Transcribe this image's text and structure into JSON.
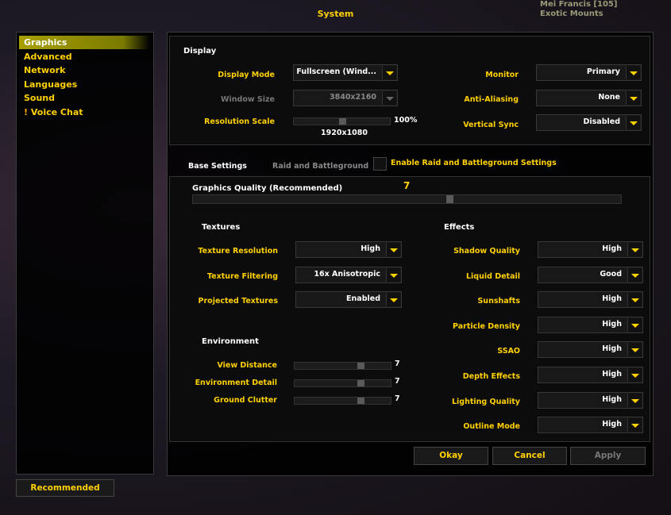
{
  "window_title": "System",
  "background_text": [
    "Mei Francis [105]",
    "Exotic Mounts"
  ],
  "colors": {
    "accent": "#ffd100",
    "selected_nav": "#a8a000"
  },
  "sidebar": {
    "items": [
      {
        "label": "Graphics",
        "selected": true
      },
      {
        "label": "Advanced"
      },
      {
        "label": "Network"
      },
      {
        "label": "Languages"
      },
      {
        "label": "Sound"
      },
      {
        "label": "Voice Chat",
        "icon": "exclamation-icon"
      }
    ]
  },
  "display": {
    "heading": "Display",
    "display_mode": {
      "label": "Display Mode",
      "value": "Fullscreen (Wind..."
    },
    "window_size": {
      "label": "Window Size",
      "value": "3840x2160"
    },
    "resolution_scale": {
      "label": "Resolution Scale",
      "value": "100%",
      "resolution": "1920x1080",
      "percent": 50
    },
    "monitor": {
      "label": "Monitor",
      "value": "Primary"
    },
    "anti_aliasing": {
      "label": "Anti-Aliasing",
      "value": "None"
    },
    "vertical_sync": {
      "label": "Vertical Sync",
      "value": "Disabled"
    }
  },
  "tabs": {
    "base": "Base Settings",
    "raid": "Raid and Battleground",
    "enable_raid": "Enable Raid and Battleground Settings",
    "enable_raid_checked": false
  },
  "graphics_quality": {
    "label": "Graphics Quality (Recommended)",
    "value": "7",
    "fraction": 0.6
  },
  "textures": {
    "heading": "Textures",
    "items": [
      {
        "label": "Texture Resolution",
        "value": "High"
      },
      {
        "label": "Texture Filtering",
        "value": "16x Anisotropic"
      },
      {
        "label": "Projected Textures",
        "value": "Enabled"
      }
    ]
  },
  "environment": {
    "heading": "Environment",
    "items": [
      {
        "label": "View Distance",
        "value": "7"
      },
      {
        "label": "Environment Detail",
        "value": "7"
      },
      {
        "label": "Ground Clutter",
        "value": "7"
      }
    ]
  },
  "effects": {
    "heading": "Effects",
    "items": [
      {
        "label": "Shadow Quality",
        "value": "High"
      },
      {
        "label": "Liquid Detail",
        "value": "Good"
      },
      {
        "label": "Sunshafts",
        "value": "High"
      },
      {
        "label": "Particle Density",
        "value": "High"
      },
      {
        "label": "SSAO",
        "value": "High"
      },
      {
        "label": "Depth Effects",
        "value": "High"
      },
      {
        "label": "Lighting Quality",
        "value": "High"
      },
      {
        "label": "Outline Mode",
        "value": "High"
      }
    ]
  },
  "buttons": {
    "okay": "Okay",
    "cancel": "Cancel",
    "apply": "Apply",
    "recommended": "Recommended"
  }
}
